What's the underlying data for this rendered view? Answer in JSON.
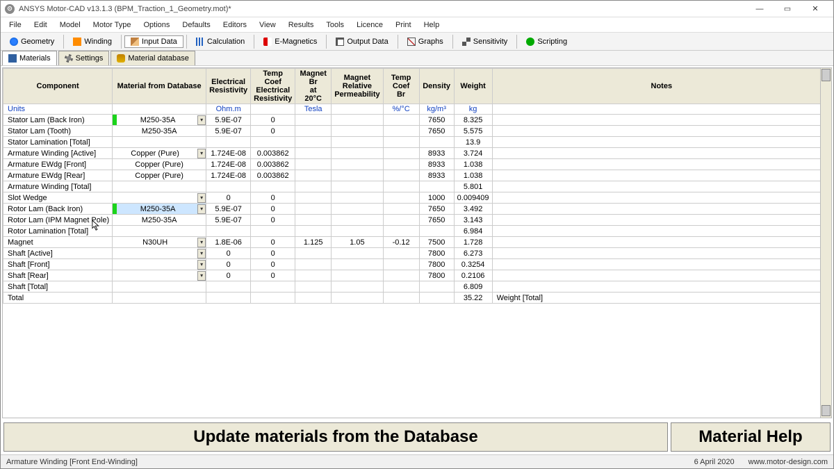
{
  "title": "ANSYS Motor-CAD v13.1.3 (BPM_Traction_1_Geometry.mot)*",
  "winbtns": {
    "min": "—",
    "max": "▭",
    "close": "✕"
  },
  "menu": [
    "File",
    "Edit",
    "Model",
    "Motor Type",
    "Options",
    "Defaults",
    "Editors",
    "View",
    "Results",
    "Tools",
    "Licence",
    "Print",
    "Help"
  ],
  "toolbar": [
    {
      "label": "Geometry",
      "icon": "ic-blue"
    },
    {
      "label": "Winding",
      "icon": "ic-orange"
    },
    {
      "label": "Input Data",
      "icon": "ic-pencil",
      "active": true
    },
    {
      "label": "Calculation",
      "icon": "ic-bars"
    },
    {
      "label": "E-Magnetics",
      "icon": "ic-mag"
    },
    {
      "label": "Output Data",
      "icon": "ic-grid"
    },
    {
      "label": "Graphs",
      "icon": "ic-chart"
    },
    {
      "label": "Sensitivity",
      "icon": "ic-sens"
    },
    {
      "label": "Scripting",
      "icon": "ic-play"
    }
  ],
  "subtabs": [
    {
      "label": "Materials",
      "icon": "ic-box",
      "active": true
    },
    {
      "label": "Settings",
      "icon": "ic-gear"
    },
    {
      "label": "Material database",
      "icon": "ic-db"
    }
  ],
  "columns": [
    "Component",
    "Material from Database",
    "Electrical Resistivity",
    "Temp Coef Electrical Resistivity",
    "Magnet Br at 20°C",
    "Magnet Relative Permeability",
    "Temp Coef Br",
    "Density",
    "Weight",
    "Notes"
  ],
  "units": [
    "Units",
    "",
    "Ohm.m",
    "",
    "Tesla",
    "",
    "%/°C",
    "kg/m³",
    "kg",
    ""
  ],
  "rows": [
    {
      "comp": "Stator Lam (Back Iron)",
      "mat": "M250-35A",
      "swatch": "g",
      "dd": true,
      "er": "5.9E-07",
      "tc": "0",
      "br": "",
      "mp": "",
      "tcb": "",
      "den": "7650",
      "wt": "8.325",
      "notes": ""
    },
    {
      "comp": "Stator Lam (Tooth)",
      "mat": "M250-35A",
      "er": "5.9E-07",
      "tc": "0",
      "br": "",
      "mp": "",
      "tcb": "",
      "den": "7650",
      "wt": "5.575",
      "notes": ""
    },
    {
      "comp": "Stator Lamination [Total]",
      "mat": "",
      "er": "",
      "tc": "",
      "br": "",
      "mp": "",
      "tcb": "",
      "den": "",
      "wt": "13.9",
      "notes": ""
    },
    {
      "comp": "Armature Winding [Active]",
      "mat": "Copper (Pure)",
      "dd": true,
      "er": "1.724E-08",
      "tc": "0.003862",
      "br": "",
      "mp": "",
      "tcb": "",
      "den": "8933",
      "wt": "3.724",
      "notes": ""
    },
    {
      "comp": "Armature EWdg [Front]",
      "mat": "Copper (Pure)",
      "er": "1.724E-08",
      "tc": "0.003862",
      "br": "",
      "mp": "",
      "tcb": "",
      "den": "8933",
      "wt": "1.038",
      "notes": ""
    },
    {
      "comp": "Armature EWdg [Rear]",
      "mat": "Copper (Pure)",
      "er": "1.724E-08",
      "tc": "0.003862",
      "br": "",
      "mp": "",
      "tcb": "",
      "den": "8933",
      "wt": "1.038",
      "notes": ""
    },
    {
      "comp": "Armature Winding [Total]",
      "mat": "",
      "er": "",
      "tc": "",
      "br": "",
      "mp": "",
      "tcb": "",
      "den": "",
      "wt": "5.801",
      "notes": ""
    },
    {
      "comp": "Slot Wedge",
      "mat": "",
      "dd": true,
      "er": "0",
      "tc": "0",
      "br": "",
      "mp": "",
      "tcb": "",
      "den": "1000",
      "wt": "0.009409",
      "notes": ""
    },
    {
      "comp": "Rotor Lam (Back Iron)",
      "mat": "M250-35A",
      "swatch": "g",
      "dd": true,
      "selected": true,
      "er": "5.9E-07",
      "tc": "0",
      "br": "",
      "mp": "",
      "tcb": "",
      "den": "7650",
      "wt": "3.492",
      "notes": ""
    },
    {
      "comp": "Rotor Lam (IPM Magnet Pole)",
      "mat": "M250-35A",
      "er": "5.9E-07",
      "tc": "0",
      "br": "",
      "mp": "",
      "tcb": "",
      "den": "7650",
      "wt": "3.143",
      "notes": ""
    },
    {
      "comp": "Rotor Lamination [Total]",
      "mat": "",
      "er": "",
      "tc": "",
      "br": "",
      "mp": "",
      "tcb": "",
      "den": "",
      "wt": "6.984",
      "notes": ""
    },
    {
      "comp": "Magnet",
      "mat": "N30UH",
      "dd": true,
      "er": "1.8E-06",
      "tc": "0",
      "br": "1.125",
      "mp": "1.05",
      "tcb": "-0.12",
      "den": "7500",
      "wt": "1.728",
      "notes": ""
    },
    {
      "comp": "Shaft [Active]",
      "mat": "",
      "dd": true,
      "er": "0",
      "tc": "0",
      "br": "",
      "mp": "",
      "tcb": "",
      "den": "7800",
      "wt": "6.273",
      "notes": ""
    },
    {
      "comp": "Shaft [Front]",
      "mat": "",
      "dd": true,
      "er": "0",
      "tc": "0",
      "br": "",
      "mp": "",
      "tcb": "",
      "den": "7800",
      "wt": "0.3254",
      "notes": ""
    },
    {
      "comp": "Shaft [Rear]",
      "mat": "",
      "dd": true,
      "er": "0",
      "tc": "0",
      "br": "",
      "mp": "",
      "tcb": "",
      "den": "7800",
      "wt": "0.2106",
      "notes": ""
    },
    {
      "comp": "Shaft [Total]",
      "mat": "",
      "er": "",
      "tc": "",
      "br": "",
      "mp": "",
      "tcb": "",
      "den": "",
      "wt": "6.809",
      "notes": ""
    },
    {
      "comp": "Total",
      "mat": "",
      "er": "",
      "tc": "",
      "br": "",
      "mp": "",
      "tcb": "",
      "den": "",
      "wt": "35.22",
      "notes": "Weight [Total]"
    }
  ],
  "bigbtns": {
    "update": "Update materials from the Database",
    "help": "Material Help"
  },
  "status": {
    "left": "Armature Winding [Front End-Winding]",
    "date": "6 April 2020",
    "url": "www.motor-design.com"
  }
}
